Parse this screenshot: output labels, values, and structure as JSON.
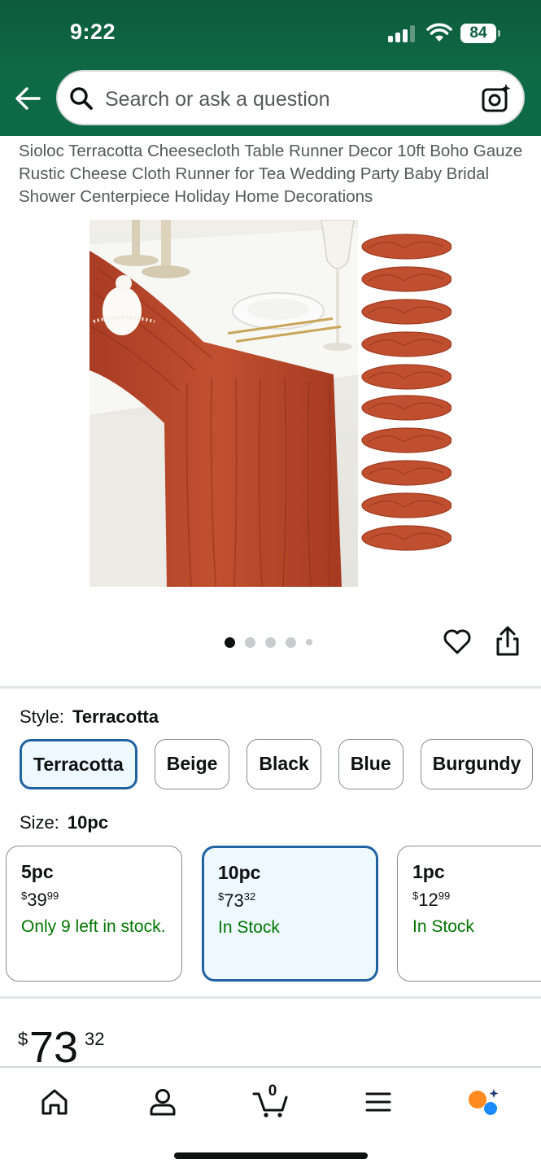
{
  "status_bar": {
    "time": "9:22",
    "battery": "84"
  },
  "search": {
    "placeholder": "Search or ask a question"
  },
  "product": {
    "title": "Sioloc Terracotta Cheesecloth Table Runner Decor 10ft Boho Gauze Rustic Cheese Cloth Runner for Tea Wedding Party Baby Bridal Shower Centerpiece Holiday Home Decorations",
    "image_count_dots": 5,
    "active_image_index": 0
  },
  "style": {
    "label": "Style:",
    "selected": "Terracotta",
    "options": [
      "Terracotta",
      "Beige",
      "Black",
      "Blue",
      "Burgundy"
    ]
  },
  "size": {
    "label": "Size:",
    "selected": "10pc",
    "options": [
      {
        "name": "5pc",
        "price_currency": "$",
        "price_whole": "39",
        "price_fraction": "99",
        "stock": "Only 9 left in stock."
      },
      {
        "name": "10pc",
        "price_currency": "$",
        "price_whole": "73",
        "price_fraction": "32",
        "stock": "In Stock"
      },
      {
        "name": "1pc",
        "price_currency": "$",
        "price_whole": "12",
        "price_fraction": "99",
        "stock": "In Stock"
      }
    ]
  },
  "price": {
    "currency": "$",
    "whole": "73",
    "fraction": "32"
  },
  "nav": [
    "home-icon",
    "account-icon",
    "cart-icon",
    "menu-icon",
    "rufus-icon"
  ],
  "cart_count": "0",
  "colors": {
    "header_green": "#0d6a47",
    "selected_border": "#2162a1",
    "selected_bg": "#edf8ff",
    "stock_green": "#007600",
    "terracotta": "#b8452a"
  }
}
